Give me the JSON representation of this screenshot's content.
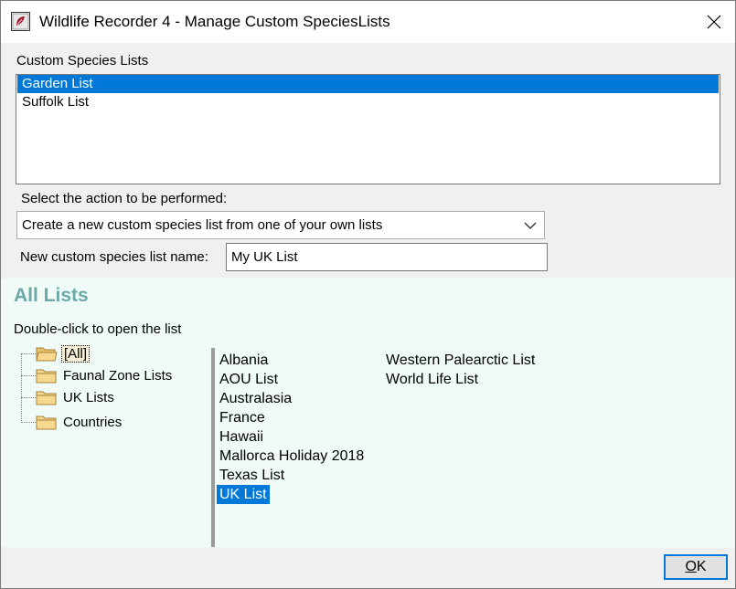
{
  "window": {
    "title": "Wildlife Recorder 4 - Manage Custom SpeciesLists",
    "app_icon": "wildlife-recorder-app-icon",
    "close_icon": "close-x-icon"
  },
  "custom_lists": {
    "label": "Custom Species Lists",
    "items": [
      {
        "label": "Garden List",
        "selected": true
      },
      {
        "label": "Suffolk List",
        "selected": false
      }
    ]
  },
  "action": {
    "label": "Select the action to be performed:",
    "selected_value": "Create a new custom species list from one of your own lists",
    "dropdown_icon": "chevron-down-icon"
  },
  "new_name": {
    "label": "New custom species list name:",
    "value": "My UK List"
  },
  "all_lists": {
    "title": "All Lists",
    "hint": "Double-click to open the list",
    "title_color": "#6aa9a5",
    "tree": [
      {
        "label": "[All]",
        "icon": "folder-open-icon",
        "focused": true
      },
      {
        "label": "Faunal Zone Lists",
        "icon": "folder-icon",
        "focused": false
      },
      {
        "label": "UK Lists",
        "icon": "folder-icon",
        "focused": false
      },
      {
        "label": "Countries",
        "icon": "folder-icon",
        "focused": false
      }
    ],
    "column1": [
      {
        "label": "Albania",
        "selected": false
      },
      {
        "label": "AOU List",
        "selected": false
      },
      {
        "label": "Australasia",
        "selected": false
      },
      {
        "label": "France",
        "selected": false
      },
      {
        "label": "Hawaii",
        "selected": false
      },
      {
        "label": "Mallorca Holiday 2018",
        "selected": false
      },
      {
        "label": "Texas List",
        "selected": false
      },
      {
        "label": "UK List",
        "selected": true
      }
    ],
    "column2": [
      {
        "label": "Western Palearctic List",
        "selected": false
      },
      {
        "label": "World Life List",
        "selected": false
      }
    ]
  },
  "footer": {
    "ok_mnemonic": "O",
    "ok_rest": "K"
  },
  "colors": {
    "selection": "#0078d7",
    "lower_panel_bg": "#f0fbf8"
  }
}
